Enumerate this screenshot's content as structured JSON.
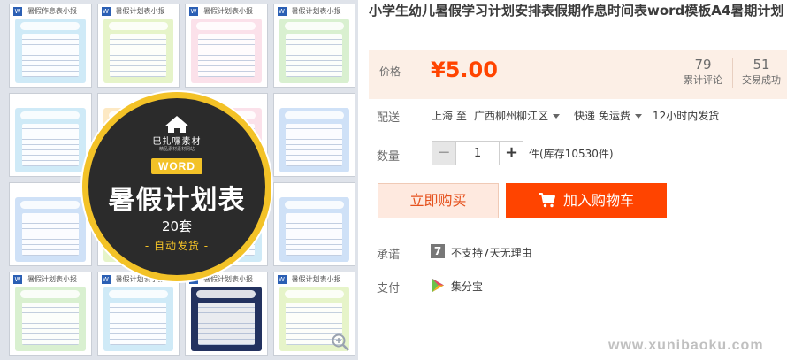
{
  "product": {
    "title": "小学生幼儿暑假学习计划安排表假期作息时间表word模板A4暑期计划",
    "image": {
      "brand_name": "巴扎嘿素材",
      "brand_sub": "精品素材素材网站",
      "format_badge": "WORD",
      "main_title": "暑假计划表",
      "set_count": "20套",
      "auto_ship": "- 自动发货 -",
      "thumb_titles": [
        "暑假作息表小报",
        "暑假计划表小报",
        "暑假计划表小报",
        "暑假计划表小报",
        "暑假计划表小报",
        "暑假计划表小报",
        "暑假计划表小报",
        "暑假计划表小报"
      ],
      "zoom_icon": "zoom-in-icon"
    }
  },
  "price": {
    "label": "价格",
    "value": "¥5.00",
    "reviews_count": "79",
    "reviews_label": "累计评论",
    "sales_count": "51",
    "sales_label": "交易成功"
  },
  "shipping": {
    "label": "配送",
    "from": "上海 至",
    "to": "广西柳州柳江区",
    "method": "快递 免运费",
    "time": "12小时内发货"
  },
  "quantity": {
    "label": "数量",
    "value": "1",
    "minus": "−",
    "plus": "+",
    "stock": "件(库存10530件)"
  },
  "actions": {
    "buy_now": "立即购买",
    "add_to_cart": "加入购物车"
  },
  "promise": {
    "label": "承诺",
    "icon_char": "7",
    "text": "不支持7天无理由"
  },
  "payment": {
    "label": "支付",
    "text": "集分宝"
  },
  "watermark": "www.xunibaoku.com",
  "colors": {
    "accent": "#ff4400",
    "price": "#ff4400",
    "badge_yellow": "#f3c227",
    "badge_dark": "#2b2b2b"
  }
}
